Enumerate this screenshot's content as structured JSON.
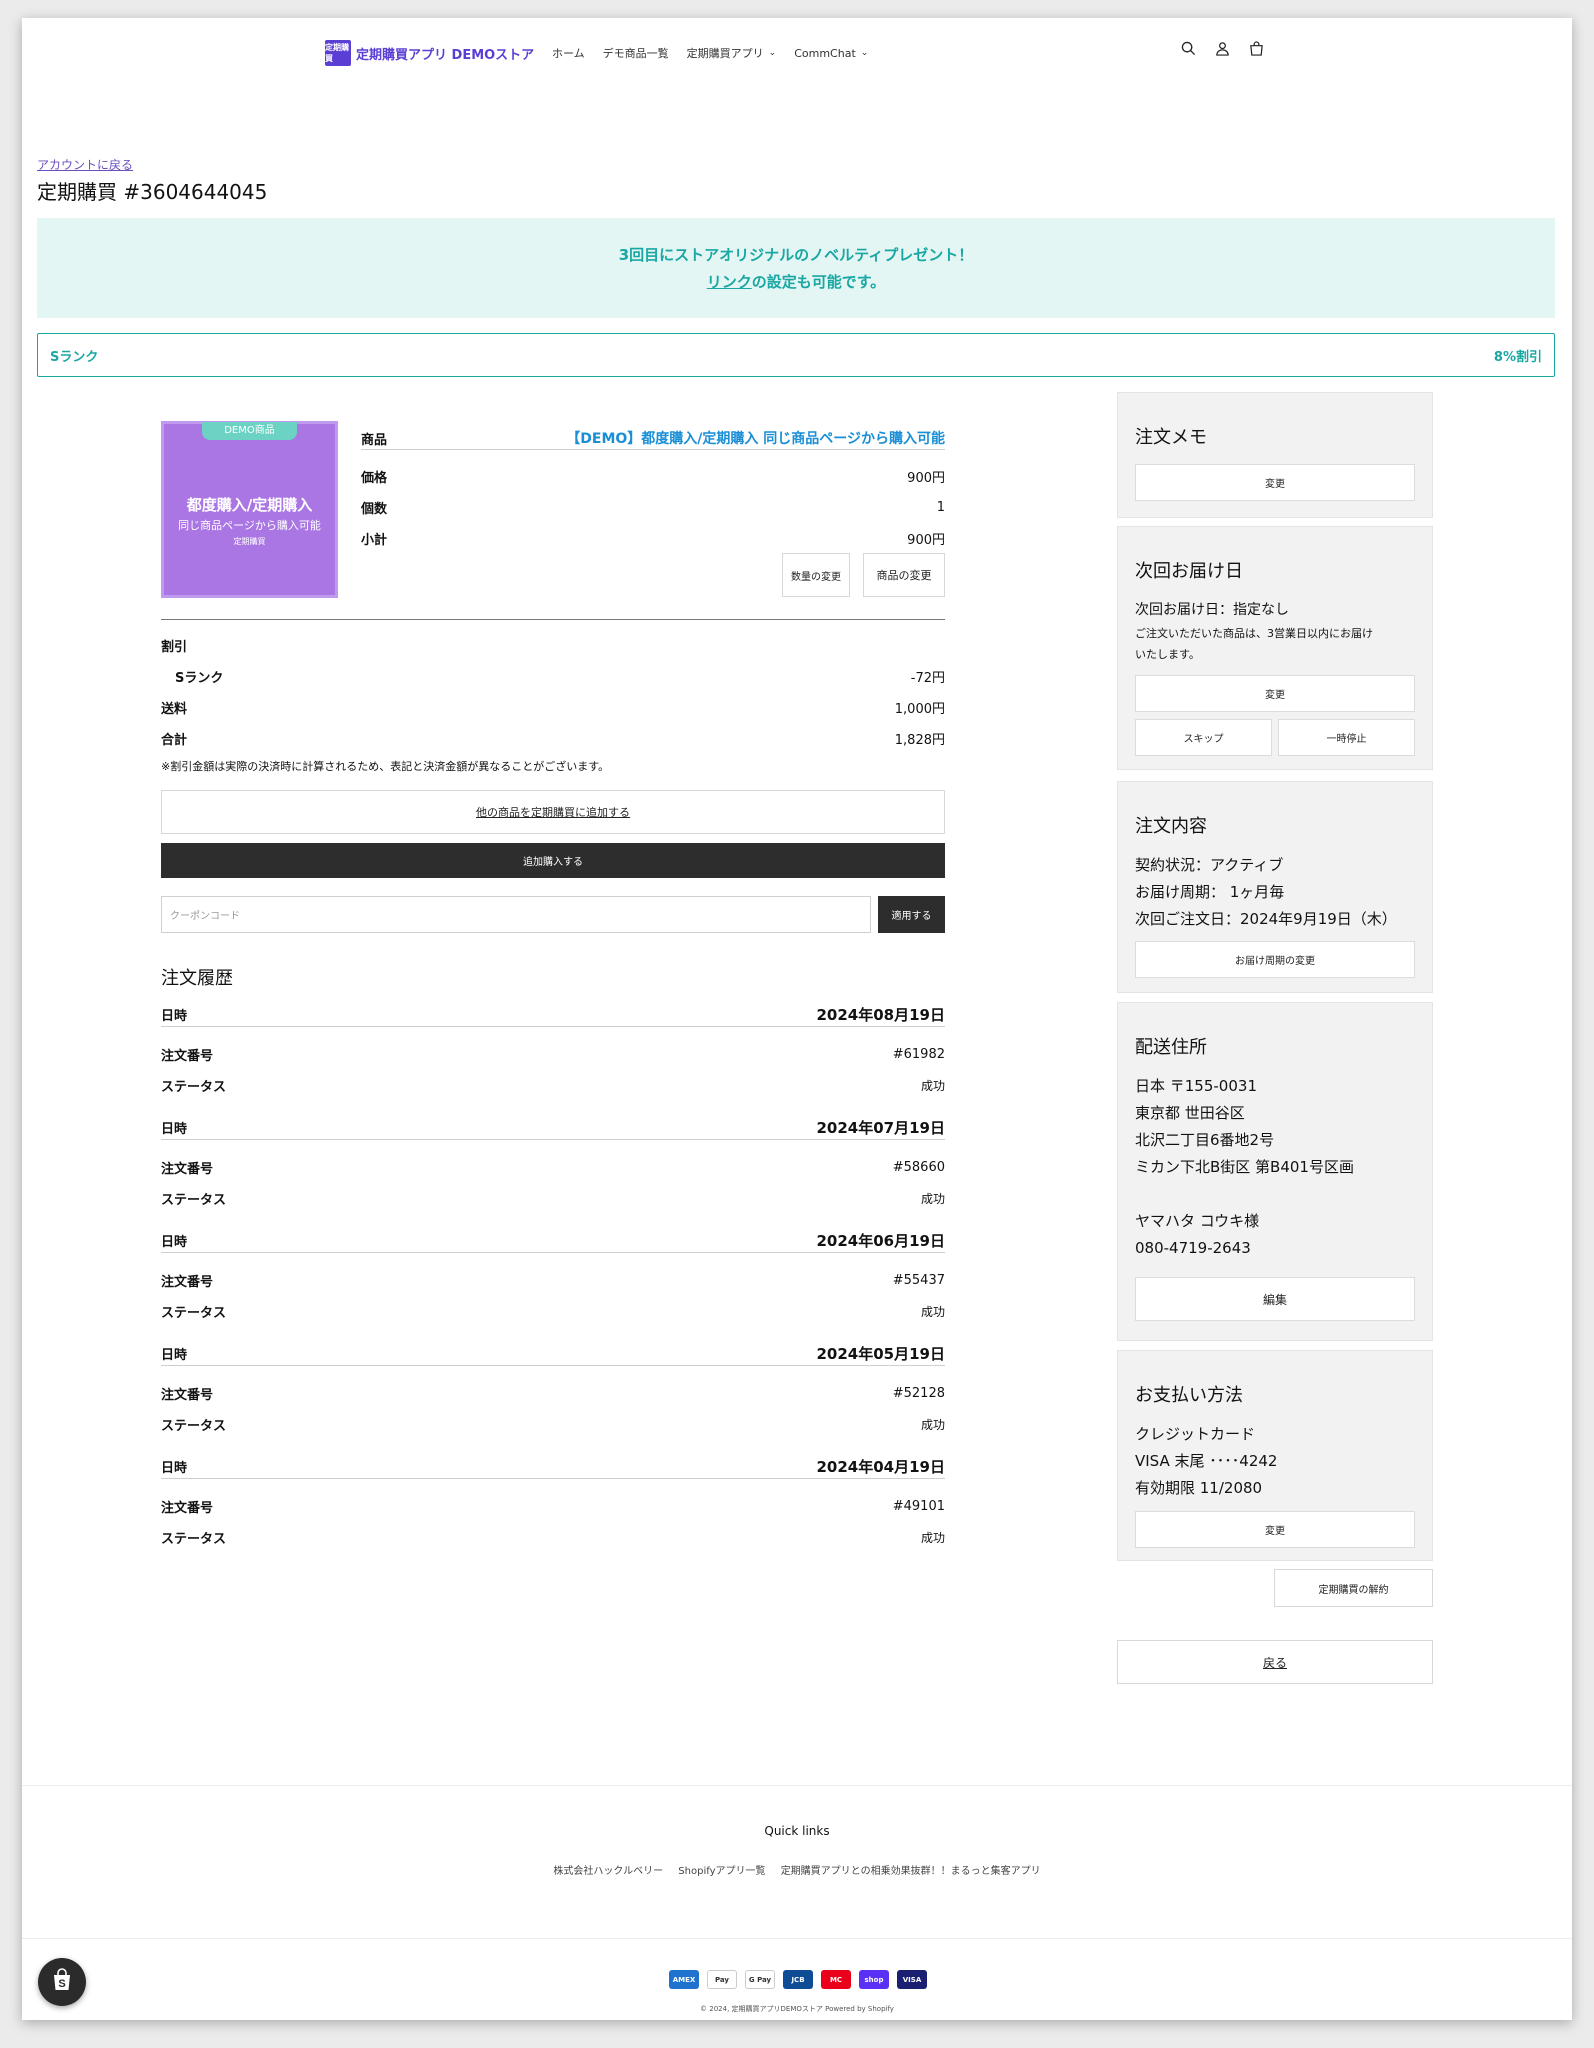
{
  "header": {
    "logo_mark": "定期購買",
    "store_name": "定期購買アプリ DEMOストア",
    "nav": [
      {
        "label": "ホーム"
      },
      {
        "label": "デモ商品一覧"
      },
      {
        "label": "定期購買アプリ",
        "dropdown": true
      },
      {
        "label": "CommChat",
        "dropdown": true
      }
    ],
    "icons": [
      "search-icon",
      "account-icon",
      "cart-icon"
    ]
  },
  "back_link": "アカウントに戻る",
  "title": "定期購買 #3604644045",
  "banner": {
    "line1": "3回目にストアオリジナルのノベルティプレゼント！",
    "link": "リンク",
    "line2_rest": "の設定も可能です。"
  },
  "rank": {
    "name": "Sランク",
    "discount": "8%割引"
  },
  "product": {
    "image": {
      "tag": "DEMO商品",
      "title": "都度購入/定期購入",
      "subtitle": "同じ商品ページから購入可能",
      "brand": "定期購買"
    },
    "label_product": "商品",
    "name": "【DEMO】都度購入/定期購入 同じ商品ページから購入可能",
    "rows": [
      {
        "label": "価格",
        "value": "900円"
      },
      {
        "label": "個数",
        "value": "1"
      },
      {
        "label": "小計",
        "value": "900円"
      }
    ],
    "change_qty": "数量の変更",
    "change_product": "商品の変更"
  },
  "summary": {
    "discount_label": "割引",
    "rank_label": "Sランク",
    "rank_value": "-72円",
    "shipping_label": "送料",
    "shipping_value": "1,000円",
    "total_label": "合計",
    "total_value": "1,828円",
    "note": "※割引金額は実際の決済時に計算されるため、表記と決済金額が異なることがございます。"
  },
  "actions": {
    "add_other": "他の商品を定期購買に追加する",
    "add_purchase": "追加購入する",
    "coupon_placeholder": "クーポンコード",
    "apply": "適用する"
  },
  "history": {
    "title": "注文履歴",
    "date_label": "日時",
    "order_label": "注文番号",
    "status_label": "ステータス",
    "entries": [
      {
        "date": "2024年08月19日",
        "order": "#61982",
        "status": "成功"
      },
      {
        "date": "2024年07月19日",
        "order": "#58660",
        "status": "成功"
      },
      {
        "date": "2024年06月19日",
        "order": "#55437",
        "status": "成功"
      },
      {
        "date": "2024年05月19日",
        "order": "#52128",
        "status": "成功"
      },
      {
        "date": "2024年04月19日",
        "order": "#49101",
        "status": "成功"
      }
    ]
  },
  "memo": {
    "title": "注文メモ",
    "button": "変更"
  },
  "next_delivery": {
    "title": "次回お届け日",
    "text": "次回お届け日：指定なし",
    "note1": "ご注文いただいた商品は、3営業日以内にお届け",
    "note2": "いたします。",
    "change": "変更",
    "skip": "スキップ",
    "pause": "一時停止"
  },
  "order_detail": {
    "title": "注文内容",
    "status": "契約状況：アクティブ",
    "cycle": "お届け周期： 1ヶ月毎",
    "next_order": "次回ご注文日：2024年9月19日（木）",
    "change_cycle": "お届け周期の変更"
  },
  "address": {
    "title": "配送住所",
    "lines": [
      "日本 〒155-0031",
      "東京都 世田谷区",
      "北沢二丁目6番地2号",
      "ミカン下北B街区 第B401号区画",
      "",
      "ヤマハタ コウキ様",
      "080-4719-2643"
    ],
    "edit": "編集"
  },
  "payment": {
    "title": "お支払い方法",
    "lines": [
      "クレジットカード",
      "VISA 末尾 ････4242",
      "有効期限 11/2080"
    ],
    "change": "変更"
  },
  "cancel": "定期購買の解約",
  "back": "戻る",
  "footer": {
    "quick_links": "Quick links",
    "links": [
      "株式会社ハックルベリー",
      "Shopifyアプリ一覧",
      "定期購買アプリとの相乗効果抜群！！まるっと集客アプリ"
    ],
    "payments": [
      {
        "name": "AMEX",
        "color": "#1f72cd"
      },
      {
        "name": "Pay",
        "color": "#000000"
      },
      {
        "name": "G Pay",
        "color": "#5f6368"
      },
      {
        "name": "JCB",
        "color": "#0e4c96"
      },
      {
        "name": "MC",
        "color": "#eb001b"
      },
      {
        "name": "shop",
        "color": "#5a31f4"
      },
      {
        "name": "VISA",
        "color": "#1a1f71"
      }
    ],
    "copyright": "© 2024, 定期購買アプリDEMOストア Powered by Shopify"
  },
  "colors": {
    "accent": "#1aa7a3",
    "brand": "#5b3fd4",
    "link": "#1a8fd6",
    "dark": "#2d2d2d"
  }
}
